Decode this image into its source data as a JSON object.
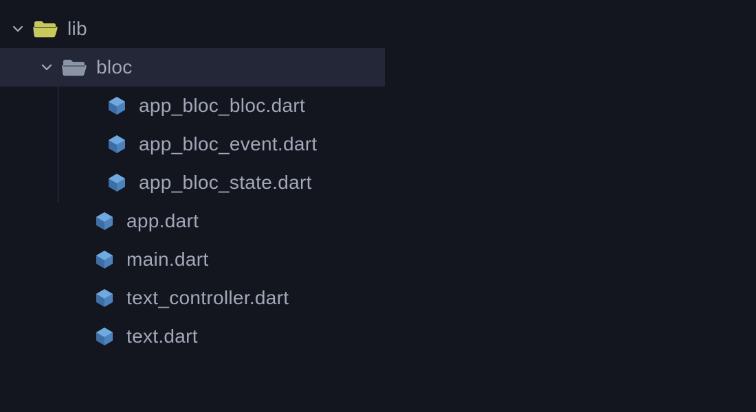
{
  "tree": {
    "root": {
      "name": "lib",
      "expanded": true
    },
    "sub": {
      "name": "bloc",
      "expanded": true,
      "selected": true
    },
    "sub_files": [
      "app_bloc_bloc.dart",
      "app_bloc_event.dart",
      "app_bloc_state.dart"
    ],
    "root_files": [
      "app.dart",
      "main.dart",
      "text_controller.dart",
      "text.dart"
    ]
  },
  "indents": {
    "base": 18,
    "level1": 56,
    "level2_chevron": 60,
    "level2_file_icon": 134,
    "level3_file_icon": 152
  },
  "colors": {
    "bg": "#14161f",
    "selected": "#232737",
    "text": "#a1a8b8",
    "chevron": "#a7adbd",
    "folder_open_yellow_fill": "#c7c95b",
    "folder_open_yellow_stroke": "#d9da77",
    "folder_grey_fill": "#8a94a6",
    "folder_grey_stroke": "#b2bac8",
    "dart_base": "#3c6fa8",
    "dart_light": "#6fa9dd",
    "guideline": "#34384a"
  }
}
